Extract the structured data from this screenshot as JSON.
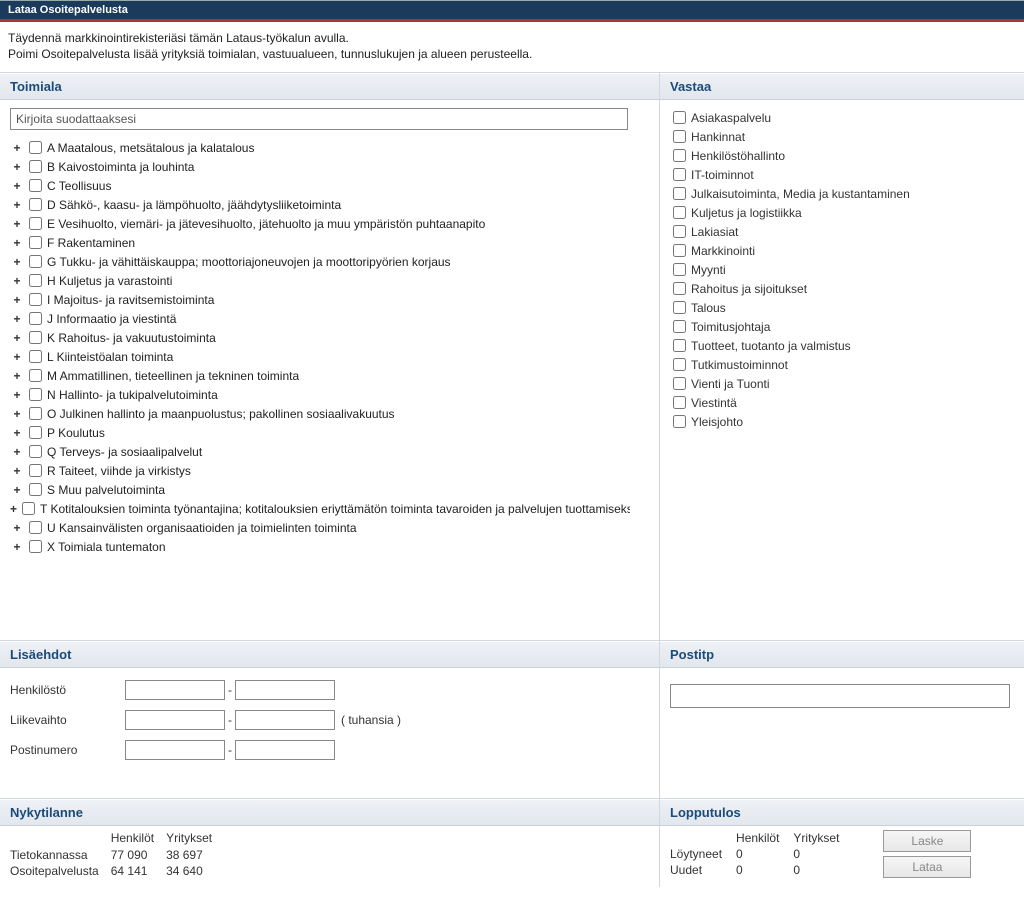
{
  "titlebar": "Lataa Osoitepalvelusta",
  "intro_line1": "Täydennä markkinointirekisteriäsi tämän Lataus-työkalun avulla.",
  "intro_line2": "Poimi Osoitepalvelusta lisää yrityksiä toimialan, vastuualueen, tunnuslukujen ja alueen perusteella.",
  "toimiala": {
    "header": "Toimiala",
    "filter_placeholder": "Kirjoita suodattaaksesi",
    "items": [
      "A Maatalous, metsätalous ja kalatalous",
      "B Kaivostoiminta ja louhinta",
      "C Teollisuus",
      "D Sähkö-, kaasu- ja lämpöhuolto, jäähdytysliiketoiminta",
      "E Vesihuolto, viemäri- ja jätevesihuolto, jätehuolto ja muu ympäristön puhtaanapito",
      "F Rakentaminen",
      "G Tukku- ja vähittäiskauppa; moottoriajoneuvojen ja moottoripyörien korjaus",
      "H Kuljetus ja varastointi",
      "I Majoitus- ja ravitsemistoiminta",
      "J Informaatio ja viestintä",
      "K Rahoitus- ja vakuutustoiminta",
      "L Kiinteistöalan toiminta",
      "M Ammatillinen, tieteellinen ja tekninen toiminta",
      "N Hallinto- ja tukipalvelutoiminta",
      "O Julkinen hallinto ja maanpuolustus; pakollinen sosiaalivakuutus",
      "P Koulutus",
      "Q Terveys- ja sosiaalipalvelut",
      "R Taiteet, viihde ja virkistys",
      "S Muu palvelutoiminta",
      "T Kotitalouksien toiminta työnantajina; kotitalouksien eriyttämätön toiminta tavaroiden ja palvelujen tuottamiseksi o...",
      "U Kansainvälisten organisaatioiden ja toimielinten toiminta",
      "X Toimiala tuntematon"
    ]
  },
  "vastaa": {
    "header": "Vastaa",
    "items": [
      "Asiakaspalvelu",
      "Hankinnat",
      "Henkilöstöhallinto",
      "IT-toiminnot",
      "Julkaisutoiminta, Media ja kustantaminen",
      "Kuljetus ja logistiikka",
      "Lakiasiat",
      "Markkinointi",
      "Myynti",
      "Rahoitus ja sijoitukset",
      "Talous",
      "Toimitusjohtaja",
      "Tuotteet, tuotanto ja valmistus",
      "Tutkimustoiminnot",
      "Vienti ja Tuonti",
      "Viestintä",
      "Yleisjohto"
    ]
  },
  "lisaehdot": {
    "header": "Lisäehdot",
    "henkilosto_label": "Henkilöstö",
    "liikevaihto_label": "Liikevaihto",
    "liikevaihto_unit": "( tuhansia )",
    "postinumero_label": "Postinumero"
  },
  "postitp": {
    "header": "Postitp"
  },
  "nykytilanne": {
    "header": "Nykytilanne",
    "col1": "Henkilöt",
    "col2": "Yritykset",
    "row1_label": "Tietokannassa",
    "row1_v1": "77 090",
    "row1_v2": "38 697",
    "row2_label": "Osoitepalvelusta",
    "row2_v1": "64 141",
    "row2_v2": "34 640"
  },
  "lopputulos": {
    "header": "Lopputulos",
    "col1": "Henkilöt",
    "col2": "Yritykset",
    "row1_label": "Löytyneet",
    "row1_v1": "0",
    "row1_v2": "0",
    "row2_label": "Uudet",
    "row2_v1": "0",
    "row2_v2": "0",
    "btn_laske": "Laske",
    "btn_lataa": "Lataa"
  }
}
